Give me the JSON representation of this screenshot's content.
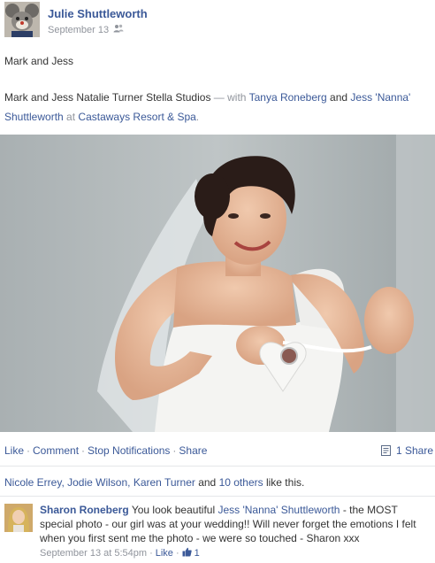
{
  "post": {
    "author": "Julie Shuttleworth",
    "date": "September 13",
    "audience_icon": "friends-icon",
    "caption": "Mark and Jess",
    "body_intro": "Mark and Jess Natalie Turner Stella Studios",
    "with_text": "— with",
    "tagged_1": "Tanya Roneberg",
    "and_text": "and",
    "tagged_2": "Jess 'Nanna' Shuttleworth",
    "at_text": "at",
    "place": "Castaways Resort & Spa",
    "period": "."
  },
  "actions": {
    "like": "Like",
    "comment": "Comment",
    "stop_notifications": "Stop Notifications",
    "share": "Share",
    "share_count": "1 Share",
    "separator": "·"
  },
  "likes": {
    "names": "Nicole Errey, Jodie Wilson, Karen Turner",
    "and_text": "and",
    "others": "10 others",
    "suffix": "like this."
  },
  "comment": {
    "name": "Sharon Roneberg",
    "text_1": "You look beautiful",
    "mention": "Jess 'Nanna' Shuttleworth",
    "text_2": "- the MOST special photo - our girl was at your wedding!! Will never forget the emotions I felt when you first sent me the photo - we were so touched - Sharon xxx",
    "time": "September 13 at 5:54pm",
    "like": "Like",
    "like_count": "1",
    "separator": "·"
  },
  "colors": {
    "link": "#3b5998",
    "meta": "#90949c",
    "text": "#333333"
  }
}
